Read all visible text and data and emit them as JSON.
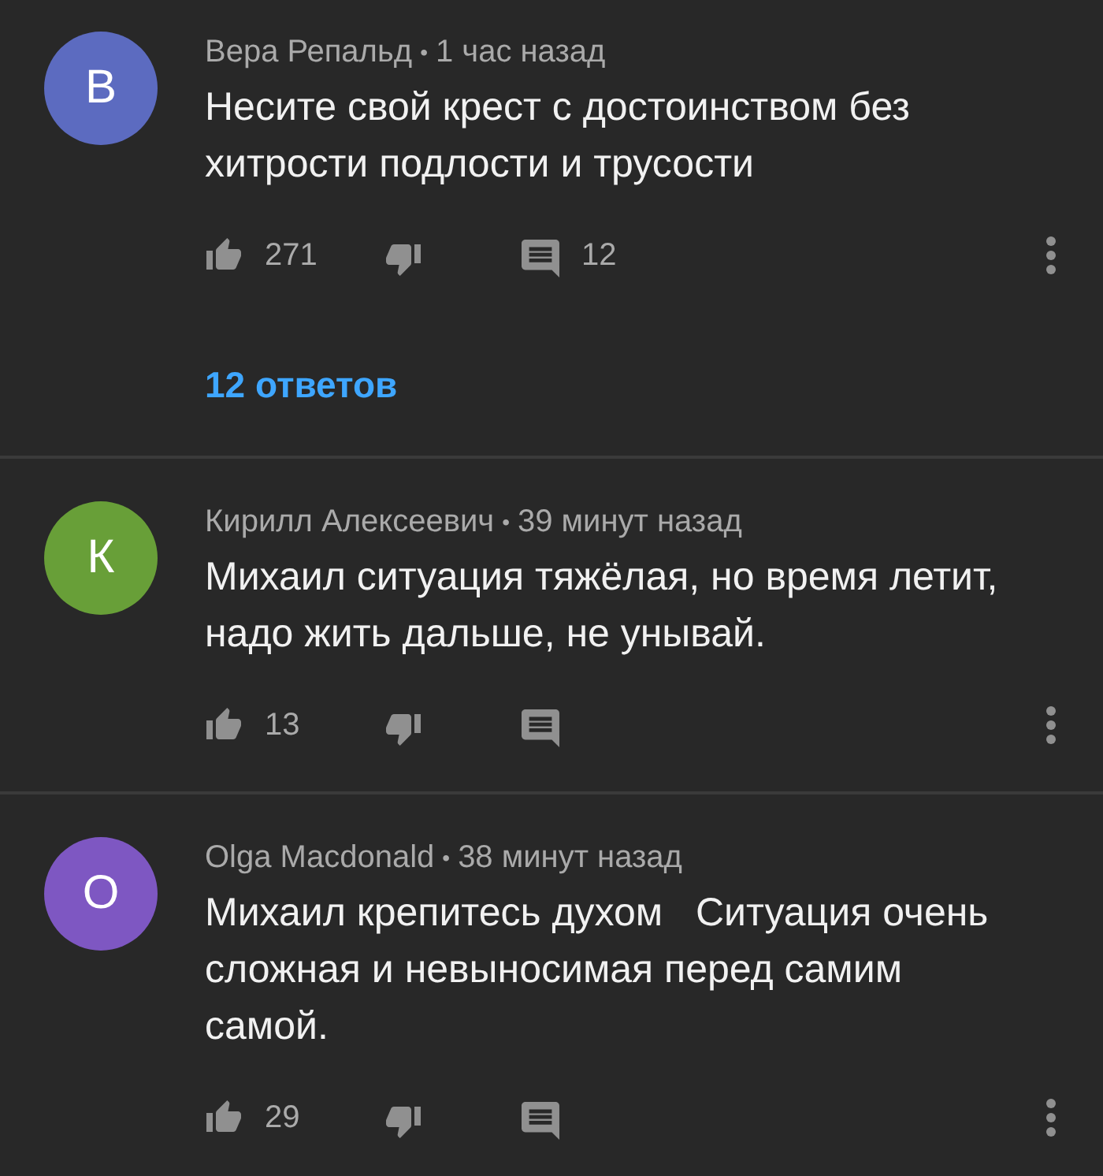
{
  "comments": [
    {
      "avatar": {
        "letter": "В",
        "color": "#5c6bc0"
      },
      "author": "Вера Репальд",
      "separator": "•",
      "time": "1 час назад",
      "text": "Несите свой крест с достоинством без хитрости подлости и трусости",
      "likes": "271",
      "reply_count": "12",
      "replies_link": "12 ответов"
    },
    {
      "avatar": {
        "letter": "К",
        "color": "#689f38"
      },
      "author": "Кирилл Алексеевич",
      "separator": "•",
      "time": "39 минут назад",
      "text": "Михаил ситуация тяжёлая, но время летит, надо жить дальше, не унывай.",
      "likes": "13"
    },
    {
      "avatar": {
        "letter": "O",
        "color": "#7e57c2"
      },
      "author": "Olga Macdonald",
      "separator": "•",
      "time": "38 минут назад",
      "text": "Михаил крепитесь духом   Ситуация очень сложная и невыносимая перед самим самой.",
      "likes": "29"
    }
  ]
}
